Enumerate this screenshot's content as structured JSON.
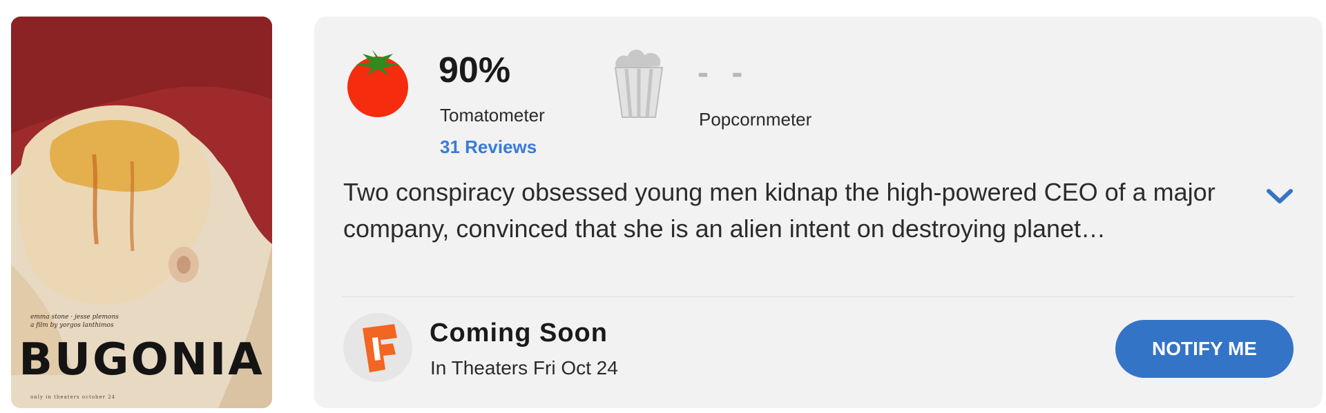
{
  "poster": {
    "title": "BUGONIA",
    "credits_line1": "emma stone · jesse plemons",
    "credits_line2": "a film by yorgos lanthimos",
    "footer": "only in theaters october 24"
  },
  "tomatometer": {
    "score": "90%",
    "label": "Tomatometer",
    "reviews_link": "31 Reviews",
    "icon": "tomato-icon"
  },
  "popcornmeter": {
    "score": "- -",
    "label": "Popcornmeter",
    "icon": "popcorn-bucket-icon"
  },
  "synopsis": {
    "text": "Two conspiracy obsessed young men kidnap the high-powered CEO of a major company, convinced that she is an alien intent on destroying planet…",
    "expand_icon": "chevron-down-icon"
  },
  "release": {
    "title": "Coming Soon",
    "subtitle": "In Theaters Fri Oct 24",
    "icon": "fandango-icon"
  },
  "notify_button": {
    "label": "NOTIFY ME"
  },
  "colors": {
    "accent_blue": "#3474c6",
    "link_blue": "#3a7bd5",
    "tomato_red": "#f52c0e",
    "stem_green": "#2f8a20",
    "fandango_orange": "#f26522",
    "card_bg": "#f2f2f2"
  }
}
